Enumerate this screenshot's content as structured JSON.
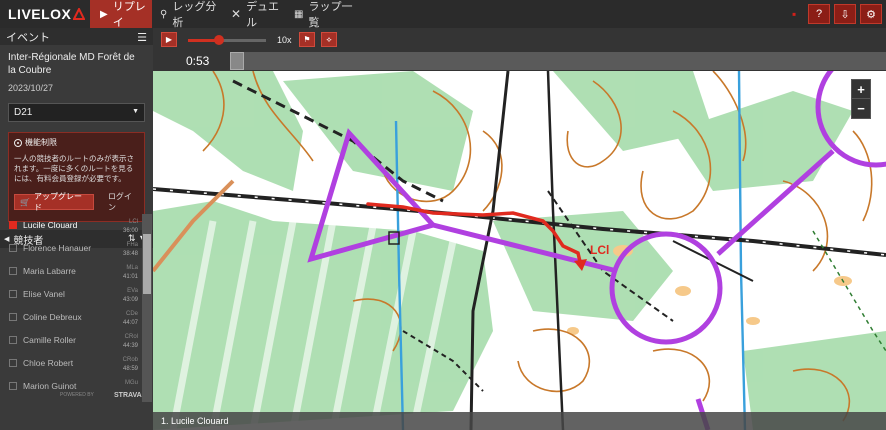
{
  "app": {
    "logo_text": "LIVELOX"
  },
  "nav": {
    "tabs": [
      {
        "label": "リプレイ",
        "icon": "play-icon",
        "active": true
      },
      {
        "label": "レッグ分析",
        "icon": "route-icon",
        "active": false
      },
      {
        "label": "デュエル",
        "icon": "cross-swords-icon",
        "active": false
      },
      {
        "label": "ラップ一覧",
        "icon": "table-icon",
        "active": false
      }
    ],
    "right_buttons": [
      {
        "label": "?",
        "icon": "help-icon"
      },
      {
        "label": "⇩",
        "icon": "download-icon"
      },
      {
        "label": "⚙",
        "icon": "gear-icon"
      }
    ],
    "accent": "#a53026"
  },
  "sidebar": {
    "event_header": "イベント",
    "event_title": "Inter-Régionale MD Forêt de la Coubre",
    "event_date": "2023/10/27",
    "class_select": "D21",
    "restriction": {
      "title": "機能制限",
      "text": "一人の競技者のルートのみが表示されます。一度に多くのルートを見るには、有料会員登録が必要です。",
      "upgrade_label": "アップグレード",
      "login_label": "ログイン"
    },
    "competitors_header": "競技者",
    "competitors": [
      {
        "name": "Lucile Clouard",
        "abbr": "LCl",
        "time": "36:00",
        "checked": true
      },
      {
        "name": "Florence Hanauer",
        "abbr": "FHa",
        "time": "38:48",
        "checked": false
      },
      {
        "name": "Maria Labarre",
        "abbr": "MLa",
        "time": "41:01",
        "checked": false
      },
      {
        "name": "Elise Vanel",
        "abbr": "EVa",
        "time": "43:09",
        "checked": false
      },
      {
        "name": "Coline Debreux",
        "abbr": "CDe",
        "time": "44:07",
        "checked": false
      },
      {
        "name": "Camille Roller",
        "abbr": "CRol",
        "time": "44:39",
        "checked": false
      },
      {
        "name": "Chloe Robert",
        "abbr": "CRob",
        "time": "48:59",
        "checked": false
      },
      {
        "name": "Marion Guinot",
        "abbr": "MGu",
        "time": "",
        "checked": false
      }
    ],
    "powered_by": "POWERED BY",
    "strava": "STRAVA"
  },
  "playback": {
    "play_icon": "▶",
    "speed_label": "10x",
    "speed_level": 0.4,
    "current_time": "0:53",
    "timeline_position": 0.0
  },
  "map": {
    "runner_label": "LCl",
    "legend": "1. Lucile Clouard",
    "zoom_in": "+",
    "zoom_out": "−",
    "colors": {
      "course": "#b040e0",
      "route": "#e02a1f",
      "contour": "#c8782a",
      "vegetation": "#9fd9a6",
      "water": "#39a0dc",
      "path": "#222222"
    }
  }
}
